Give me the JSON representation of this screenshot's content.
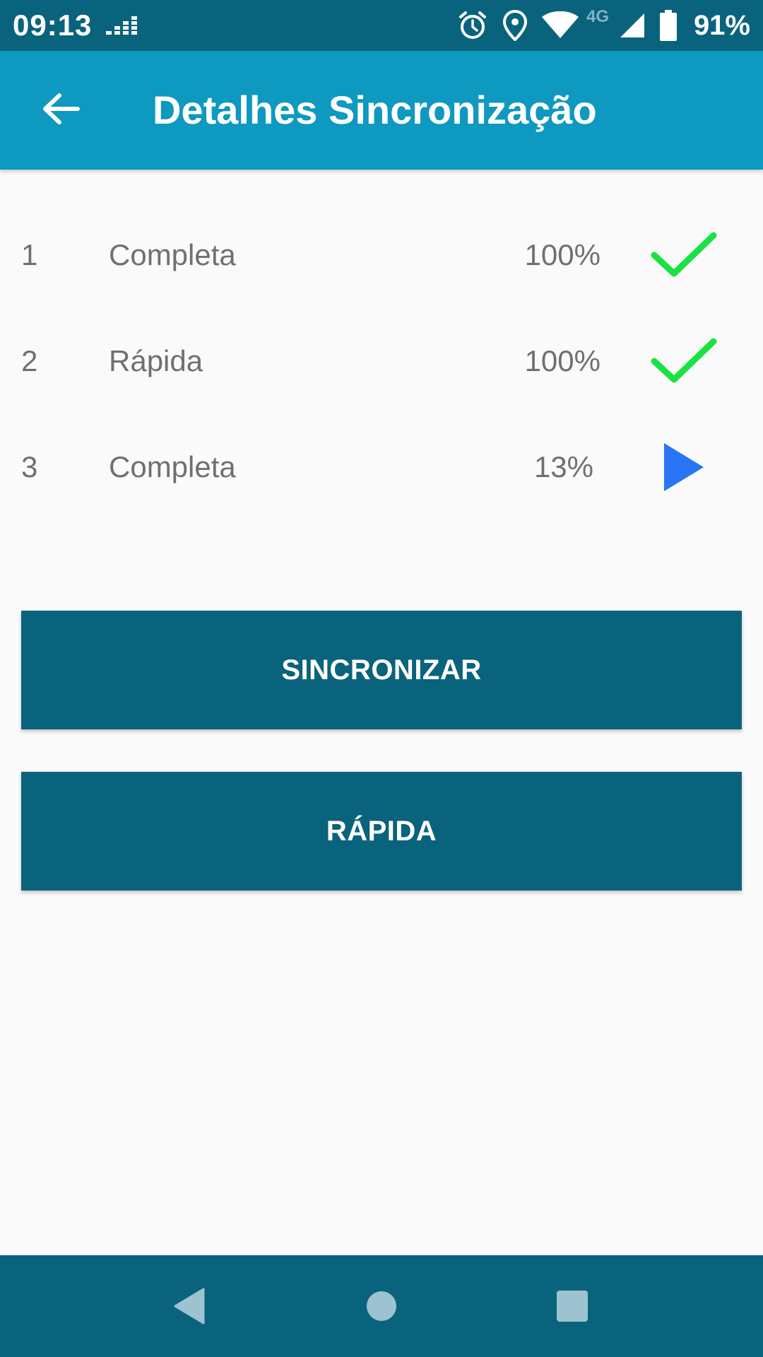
{
  "status_bar": {
    "time": "09:13",
    "network_label": "4G",
    "battery_text": "91%",
    "icons": [
      "deezer-icon",
      "alarm-icon",
      "location-icon",
      "wifi-icon",
      "signal-icon",
      "battery-icon"
    ]
  },
  "app_bar": {
    "title": "Detalhes Sincronização",
    "back_icon": "arrow-back-icon"
  },
  "sync_items": [
    {
      "number": "1",
      "name": "Completa",
      "percent": "100%",
      "status": "done",
      "status_icon": "check-icon",
      "status_color": "#19e342"
    },
    {
      "number": "2",
      "name": "Rápida",
      "percent": "100%",
      "status": "done",
      "status_icon": "check-icon",
      "status_color": "#19e342"
    },
    {
      "number": "3",
      "name": "Completa",
      "percent": "13%",
      "status": "in-progress",
      "status_icon": "play-icon",
      "status_color": "#2a75f3"
    }
  ],
  "buttons": {
    "sync_label": "SINCRONIZAR",
    "quick_label": "RÁPIDA"
  },
  "nav_bar": {
    "icons": [
      "nav-back-icon",
      "nav-home-icon",
      "nav-recents-icon"
    ]
  },
  "colors": {
    "status_bar": "#0a637c",
    "app_bar": "#0e99c0",
    "button": "#0a637c",
    "background": "#fafafa",
    "text_secondary": "#707070",
    "success": "#19e342",
    "progress": "#2a75f3"
  }
}
